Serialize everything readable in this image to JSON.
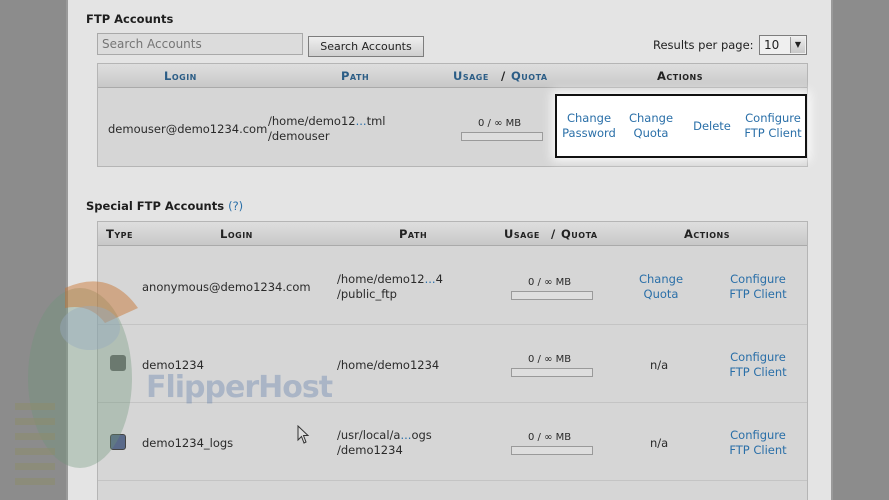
{
  "ftp_accounts": {
    "title": "FTP Accounts",
    "search_placeholder": "Search Accounts",
    "search_button": "Search Accounts",
    "results_per_page_label": "Results per page:",
    "results_per_page_value": "10",
    "headers": {
      "login": "Login",
      "path": "Path",
      "usage": "Usage",
      "slash": "/",
      "quota": "Quota",
      "actions": "Actions"
    },
    "row": {
      "login": "demouser@demo1234.com",
      "path_line1_pre": "/home/demo12",
      "path_ellipsis": "...",
      "path_line1_post": "tml",
      "path_line2": "/demouser",
      "usage": "0 / ∞ MB",
      "usage_fraction": 0,
      "actions": {
        "change_password_1": "Change",
        "change_password_2": "Password",
        "change_quota_1": "Change",
        "change_quota_2": "Quota",
        "delete": "Delete",
        "configure_1": "Configure",
        "configure_2": "FTP Client"
      }
    }
  },
  "special_ftp_accounts": {
    "title": "Special FTP Accounts",
    "help": "(?)",
    "headers": {
      "type": "Type",
      "login": "Login",
      "path": "Path",
      "usage": "Usage",
      "slash": "/",
      "quota": "Quota",
      "actions": "Actions"
    },
    "rows": [
      {
        "login": "anonymous@demo1234.com",
        "path_line1_pre": "/home/demo12",
        "path_ellipsis": "...",
        "path_line1_post": "4",
        "path_line2": "/public_ftp",
        "usage": "0 / ∞ MB",
        "usage_fraction": 0,
        "action1_a": "Change",
        "action1_b": "Quota",
        "action2_a": "Configure",
        "action2_b": "FTP Client"
      },
      {
        "login": "demo1234",
        "path_line1_pre": "/home/demo1234",
        "path_ellipsis": "",
        "path_line1_post": "",
        "path_line2": "",
        "usage": "0 / ∞ MB",
        "usage_fraction": 0,
        "action1_a": "n/a",
        "action1_b": "",
        "action2_a": "Configure",
        "action2_b": "FTP Client"
      },
      {
        "login": "demo1234_logs",
        "path_line1_pre": "/usr/local/a",
        "path_ellipsis": "...",
        "path_line1_post": "ogs",
        "path_line2": "/demo1234",
        "usage": "0 / ∞ MB",
        "usage_fraction": 0,
        "action1_a": "n/a",
        "action1_b": "",
        "action2_a": "Configure",
        "action2_b": "FTP Client"
      }
    ]
  },
  "watermark": "FlipperHost",
  "colors": {
    "link": "#2a6fa8",
    "header_blue": "#2b5d86",
    "overlay": "#8c8c8c"
  }
}
